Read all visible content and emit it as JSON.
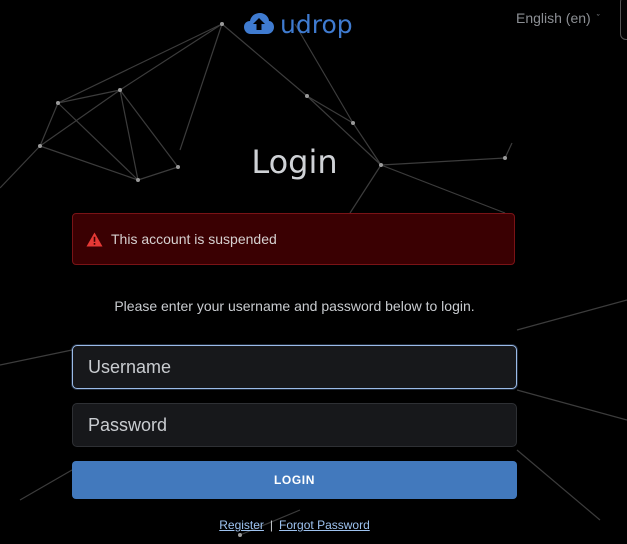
{
  "brand": {
    "name": "udrop",
    "color": "#3f7bd0"
  },
  "language": {
    "selected": "English (en)",
    "caret": "ˇ"
  },
  "login": {
    "title": "Login",
    "alert": {
      "icon": "warning-triangle-icon",
      "message": "This account is suspended",
      "color": "#e53935"
    },
    "instruction": "Please enter your username and password below to login.",
    "username_placeholder": "Username",
    "password_placeholder": "Password",
    "button_label": "LOGIN",
    "register_link": "Register",
    "separator": "|",
    "forgot_link": "Forgot Password"
  },
  "colors": {
    "background": "#000000",
    "button": "#4279bd",
    "alert_bg": "#3a0002",
    "link": "#9ec3f0"
  }
}
